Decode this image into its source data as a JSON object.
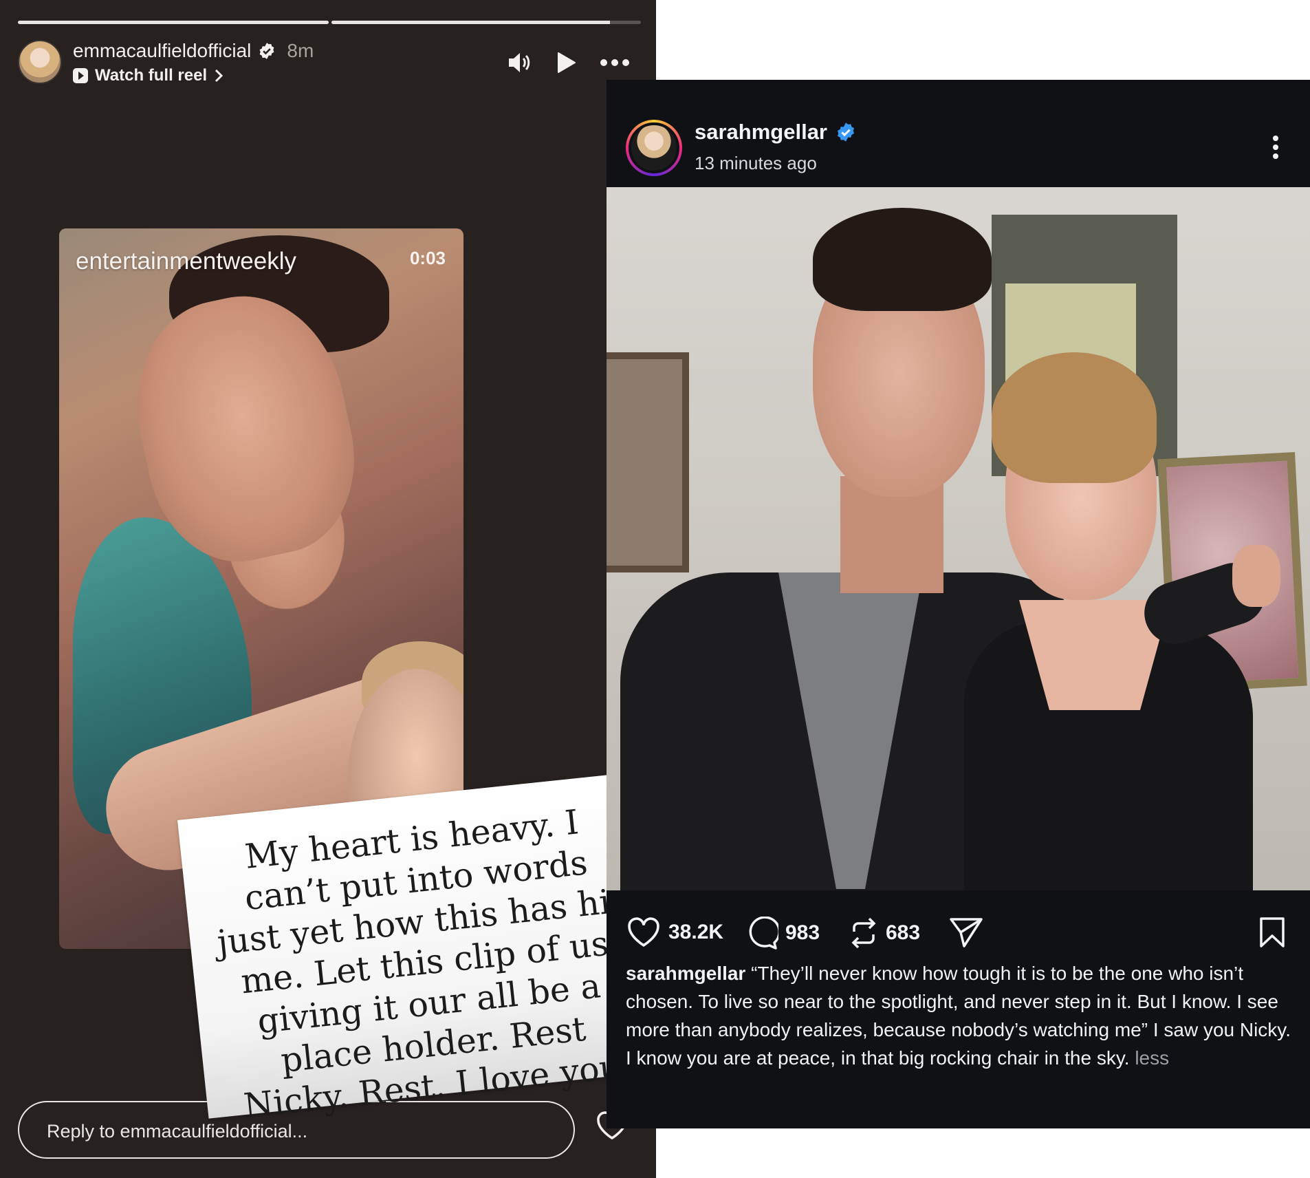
{
  "story": {
    "username": "emmacaulfieldofficial",
    "time": "8m",
    "watch_full_reel": "Watch full reel",
    "video": {
      "source": "entertainmentweekly",
      "timestamp": "0:03"
    },
    "note_text": "My heart is heavy. I can’t put into words just yet how this has hit me. Let this clip of us giving it our all be a place holder. Rest Nicky. Rest. I love you.",
    "reply_placeholder": "Reply to emmacaulfieldofficial...",
    "icons": [
      "speaker-icon",
      "play-icon",
      "more-icon",
      "verified-icon",
      "reel-icon",
      "chevron-right-icon",
      "heart-icon"
    ]
  },
  "post": {
    "username": "sarahmgellar",
    "time": "13 minutes ago",
    "likes": "38.2K",
    "comments": "983",
    "reposts": "683",
    "caption_user": "sarahmgellar",
    "caption_text": " “They’ll never know how tough it is to be the one who isn’t chosen. To live so near to the spotlight,  and never step in it. But I know. I see more than anybody realizes, because nobody’s watching me” I saw you Nicky. I know you are at peace, in that big rocking chair in the sky. ",
    "caption_less": "less",
    "verified_color": "#3897f0",
    "icons": [
      "heart-icon",
      "comment-icon",
      "repost-icon",
      "share-icon",
      "bookmark-icon",
      "more-vertical-icon"
    ]
  }
}
